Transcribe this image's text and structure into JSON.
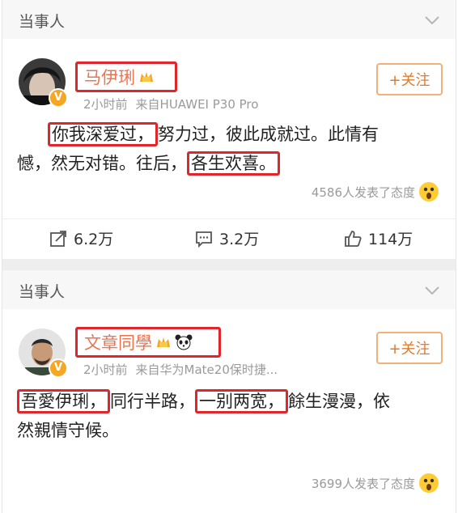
{
  "sections": [
    {
      "header": "当事人",
      "author": {
        "name": "马伊琍",
        "time": "2小时前",
        "source": "来自HUAWEI P30 Pro"
      },
      "follow_label": "+关注",
      "body": {
        "p1": "你我深爱过，",
        "p2": "努力过，彼此成就过。此情有",
        "p3": "憾，然无对错。往后，",
        "p4": "各生欢喜。"
      },
      "reactions": "4586人发表了态度",
      "actions": {
        "repost": "6.2万",
        "comment": "3.2万",
        "like": "114万"
      }
    },
    {
      "header": "当事人",
      "author": {
        "name": "文章同學",
        "time": "2小时前",
        "source": "来自华为Mate20保时捷..."
      },
      "follow_label": "+关注",
      "body": {
        "p1": "吾愛伊琍，",
        "p2": "同行半路，",
        "p3": "一别两宽，",
        "p4": "餘生漫漫，依",
        "p5": "然親情守候。"
      },
      "reactions": "3699人发表了态度"
    }
  ],
  "colors": {
    "accent": "#eb7350",
    "highlight": "#e0262b",
    "follow": "#e07a2e"
  }
}
